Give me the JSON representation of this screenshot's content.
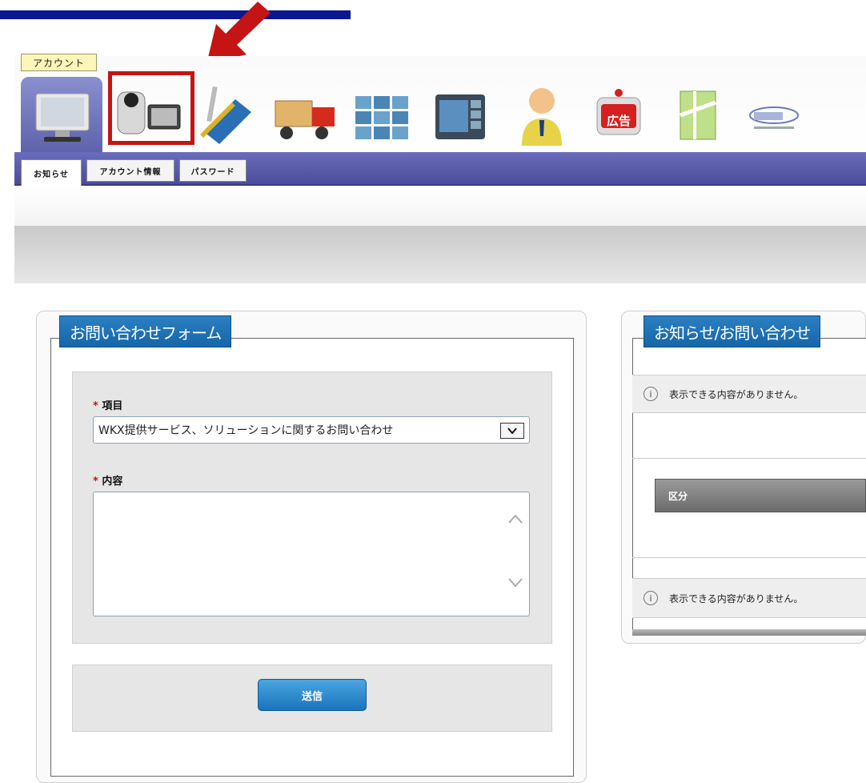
{
  "toolbar": {
    "tooltip": "アカウント",
    "icons": [
      "monitor-icon",
      "camcorder-icon",
      "card-pen-icon",
      "delivery-truck-icon",
      "video-wall-icon",
      "media-window-icon",
      "person-icon",
      "ad-badge-icon",
      "map-icon",
      "logo-icon"
    ],
    "ad_badge_label": "広告"
  },
  "tabs": {
    "notice": "お知らせ",
    "account_info": "アカウント情報",
    "password": "パスワード"
  },
  "form": {
    "title": "お問い合わせフォーム",
    "required_mark": "*",
    "item_label": "項目",
    "item_value": "WKX提供サービス、ソリューションに関するお問い合わせ",
    "content_label": "内容",
    "submit_label": "送信"
  },
  "news": {
    "title": "お知らせ/お問い合わせ",
    "empty_message_1": "表示できる内容がありません。",
    "category_header": "区分",
    "empty_message_2": "表示できる内容がありません。"
  },
  "colors": {
    "panel_title_bg": "#1566a8",
    "menu_strip": "#4a4c9a",
    "highlight": "#c41414",
    "annotation_bar": "#0c1790"
  }
}
